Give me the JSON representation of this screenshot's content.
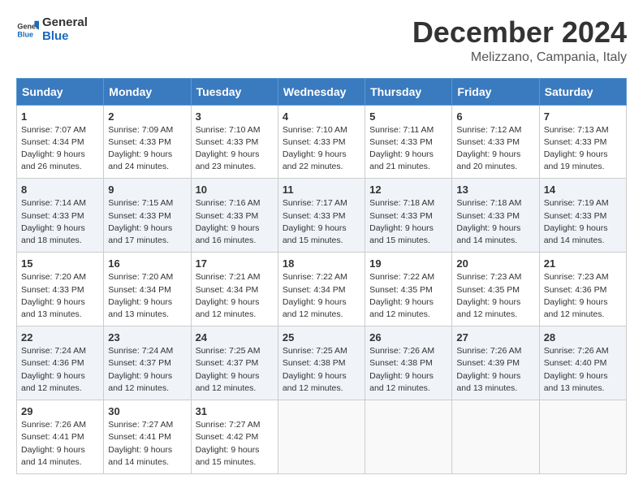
{
  "header": {
    "logo_general": "General",
    "logo_blue": "Blue",
    "month_title": "December 2024",
    "location": "Melizzano, Campania, Italy"
  },
  "weekdays": [
    "Sunday",
    "Monday",
    "Tuesday",
    "Wednesday",
    "Thursday",
    "Friday",
    "Saturday"
  ],
  "weeks": [
    [
      {
        "day": "1",
        "sunrise": "Sunrise: 7:07 AM",
        "sunset": "Sunset: 4:34 PM",
        "daylight": "Daylight: 9 hours and 26 minutes."
      },
      {
        "day": "2",
        "sunrise": "Sunrise: 7:09 AM",
        "sunset": "Sunset: 4:33 PM",
        "daylight": "Daylight: 9 hours and 24 minutes."
      },
      {
        "day": "3",
        "sunrise": "Sunrise: 7:10 AM",
        "sunset": "Sunset: 4:33 PM",
        "daylight": "Daylight: 9 hours and 23 minutes."
      },
      {
        "day": "4",
        "sunrise": "Sunrise: 7:10 AM",
        "sunset": "Sunset: 4:33 PM",
        "daylight": "Daylight: 9 hours and 22 minutes."
      },
      {
        "day": "5",
        "sunrise": "Sunrise: 7:11 AM",
        "sunset": "Sunset: 4:33 PM",
        "daylight": "Daylight: 9 hours and 21 minutes."
      },
      {
        "day": "6",
        "sunrise": "Sunrise: 7:12 AM",
        "sunset": "Sunset: 4:33 PM",
        "daylight": "Daylight: 9 hours and 20 minutes."
      },
      {
        "day": "7",
        "sunrise": "Sunrise: 7:13 AM",
        "sunset": "Sunset: 4:33 PM",
        "daylight": "Daylight: 9 hours and 19 minutes."
      }
    ],
    [
      {
        "day": "8",
        "sunrise": "Sunrise: 7:14 AM",
        "sunset": "Sunset: 4:33 PM",
        "daylight": "Daylight: 9 hours and 18 minutes."
      },
      {
        "day": "9",
        "sunrise": "Sunrise: 7:15 AM",
        "sunset": "Sunset: 4:33 PM",
        "daylight": "Daylight: 9 hours and 17 minutes."
      },
      {
        "day": "10",
        "sunrise": "Sunrise: 7:16 AM",
        "sunset": "Sunset: 4:33 PM",
        "daylight": "Daylight: 9 hours and 16 minutes."
      },
      {
        "day": "11",
        "sunrise": "Sunrise: 7:17 AM",
        "sunset": "Sunset: 4:33 PM",
        "daylight": "Daylight: 9 hours and 15 minutes."
      },
      {
        "day": "12",
        "sunrise": "Sunrise: 7:18 AM",
        "sunset": "Sunset: 4:33 PM",
        "daylight": "Daylight: 9 hours and 15 minutes."
      },
      {
        "day": "13",
        "sunrise": "Sunrise: 7:18 AM",
        "sunset": "Sunset: 4:33 PM",
        "daylight": "Daylight: 9 hours and 14 minutes."
      },
      {
        "day": "14",
        "sunrise": "Sunrise: 7:19 AM",
        "sunset": "Sunset: 4:33 PM",
        "daylight": "Daylight: 9 hours and 14 minutes."
      }
    ],
    [
      {
        "day": "15",
        "sunrise": "Sunrise: 7:20 AM",
        "sunset": "Sunset: 4:33 PM",
        "daylight": "Daylight: 9 hours and 13 minutes."
      },
      {
        "day": "16",
        "sunrise": "Sunrise: 7:20 AM",
        "sunset": "Sunset: 4:34 PM",
        "daylight": "Daylight: 9 hours and 13 minutes."
      },
      {
        "day": "17",
        "sunrise": "Sunrise: 7:21 AM",
        "sunset": "Sunset: 4:34 PM",
        "daylight": "Daylight: 9 hours and 12 minutes."
      },
      {
        "day": "18",
        "sunrise": "Sunrise: 7:22 AM",
        "sunset": "Sunset: 4:34 PM",
        "daylight": "Daylight: 9 hours and 12 minutes."
      },
      {
        "day": "19",
        "sunrise": "Sunrise: 7:22 AM",
        "sunset": "Sunset: 4:35 PM",
        "daylight": "Daylight: 9 hours and 12 minutes."
      },
      {
        "day": "20",
        "sunrise": "Sunrise: 7:23 AM",
        "sunset": "Sunset: 4:35 PM",
        "daylight": "Daylight: 9 hours and 12 minutes."
      },
      {
        "day": "21",
        "sunrise": "Sunrise: 7:23 AM",
        "sunset": "Sunset: 4:36 PM",
        "daylight": "Daylight: 9 hours and 12 minutes."
      }
    ],
    [
      {
        "day": "22",
        "sunrise": "Sunrise: 7:24 AM",
        "sunset": "Sunset: 4:36 PM",
        "daylight": "Daylight: 9 hours and 12 minutes."
      },
      {
        "day": "23",
        "sunrise": "Sunrise: 7:24 AM",
        "sunset": "Sunset: 4:37 PM",
        "daylight": "Daylight: 9 hours and 12 minutes."
      },
      {
        "day": "24",
        "sunrise": "Sunrise: 7:25 AM",
        "sunset": "Sunset: 4:37 PM",
        "daylight": "Daylight: 9 hours and 12 minutes."
      },
      {
        "day": "25",
        "sunrise": "Sunrise: 7:25 AM",
        "sunset": "Sunset: 4:38 PM",
        "daylight": "Daylight: 9 hours and 12 minutes."
      },
      {
        "day": "26",
        "sunrise": "Sunrise: 7:26 AM",
        "sunset": "Sunset: 4:38 PM",
        "daylight": "Daylight: 9 hours and 12 minutes."
      },
      {
        "day": "27",
        "sunrise": "Sunrise: 7:26 AM",
        "sunset": "Sunset: 4:39 PM",
        "daylight": "Daylight: 9 hours and 13 minutes."
      },
      {
        "day": "28",
        "sunrise": "Sunrise: 7:26 AM",
        "sunset": "Sunset: 4:40 PM",
        "daylight": "Daylight: 9 hours and 13 minutes."
      }
    ],
    [
      {
        "day": "29",
        "sunrise": "Sunrise: 7:26 AM",
        "sunset": "Sunset: 4:41 PM",
        "daylight": "Daylight: 9 hours and 14 minutes."
      },
      {
        "day": "30",
        "sunrise": "Sunrise: 7:27 AM",
        "sunset": "Sunset: 4:41 PM",
        "daylight": "Daylight: 9 hours and 14 minutes."
      },
      {
        "day": "31",
        "sunrise": "Sunrise: 7:27 AM",
        "sunset": "Sunset: 4:42 PM",
        "daylight": "Daylight: 9 hours and 15 minutes."
      },
      null,
      null,
      null,
      null
    ]
  ]
}
